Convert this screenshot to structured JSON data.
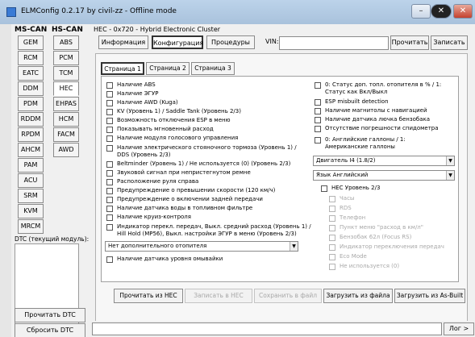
{
  "window": {
    "title": "ELMConfig 0.2.17 by civil-zz - Offline mode"
  },
  "left_panel": {
    "ms_can_label": "MS-CAN",
    "hs_can_label": "HS-CAN",
    "ms_can_buttons": [
      "GEM",
      "RCM",
      "EATC",
      "DDM",
      "PDM",
      "RDDM",
      "RPDM",
      "AHCM",
      "PAM",
      "ACU",
      "SRM",
      "KVM",
      "MRCM"
    ],
    "hs_can_buttons": [
      "ABS",
      "PCM",
      "TCM",
      "HEC",
      "EHPAS",
      "HCM",
      "FACM",
      "AWD"
    ],
    "hs_active": "HEC",
    "dtc_label": "DTC (текущий модуль):",
    "read_dtc": "Прочитать DTC",
    "clear_dtc": "Сбросить DTC"
  },
  "module": {
    "title": "HEC - 0x720 - Hybrid Electronic Cluster",
    "tabs": [
      "Информация",
      "Конфигурация",
      "Процедуры"
    ],
    "active_tab": "Конфигурация",
    "vin_label": "VIN:",
    "vin_value": "",
    "read_button": "Прочитать",
    "write_button": "Записать"
  },
  "pages": {
    "tabs": [
      "Страница 1",
      "Страница 2",
      "Страница 3"
    ],
    "active": "Страница 1"
  },
  "options_left": [
    "Наличие ABS",
    "Наличие ЭГУР",
    "Наличие AWD (Kuga)",
    "KV (Уровень 1) / Saddle Tank (Уровень 2/3)",
    "Возможность отключения ESP в меню",
    "Показывать мгновенный расход",
    "Наличие модуля голосового управления",
    "Наличие электрического стояночного тормоза (Уровень 1) / DDS (Уровень 2/3)",
    "Beltminder (Уровень 1) / Не используется (0) (Уровень 2/3)",
    "Звуковой сигнал при непристегнутом ремне",
    "Расположение руля справа",
    "Предупреждение о превышении скорости (120 км/ч)",
    "Предупреждение о включении задней передачи",
    "Наличие датчика воды в топливном фильтре",
    "Наличие круиз-контроля",
    "Индикатор перекл. передач, Выкл. средний расход (Уровень 1) / Hill Hold (MP56), Выкл. настройки ЭГУР в меню (Уровень 2/3)"
  ],
  "heater_select": "Нет дополнительного отопителя",
  "washer_option": "Наличие датчика уровня омывайки",
  "options_right": [
    "0: Статус доп. топл. отопителя в % / 1: Статус как Вкл/Выкл",
    "ESP misbuilt detection",
    "Наличие магнитолы с навигацией",
    "Наличие датчика лючка бензобака",
    "Отсутствие погрешности спидометра",
    "0: Английские галлоны / 1: Американские галлоны"
  ],
  "engine_select": "Двигатель I4 (1.8/2)",
  "language_select": "Язык Английский",
  "hec_level": {
    "label": "HEC Уровень 2/3",
    "items": [
      "Часы",
      "RDS",
      "Телефон",
      "Пункт меню \"расход в км/л\"",
      "Бензобак 62л (Focus RS)",
      "Индикатор переключения передач",
      "Eco Mode",
      "Не используется (0)"
    ]
  },
  "bottom_buttons": {
    "read_hec": "Прочитать из HEC",
    "write_hec": "Записать в HEC",
    "save_file": "Сохранить в файл",
    "load_file": "Загрузить из файла",
    "load_asbuilt": "Загрузить из As-Built"
  },
  "status": {
    "log_button": "Лог >"
  }
}
